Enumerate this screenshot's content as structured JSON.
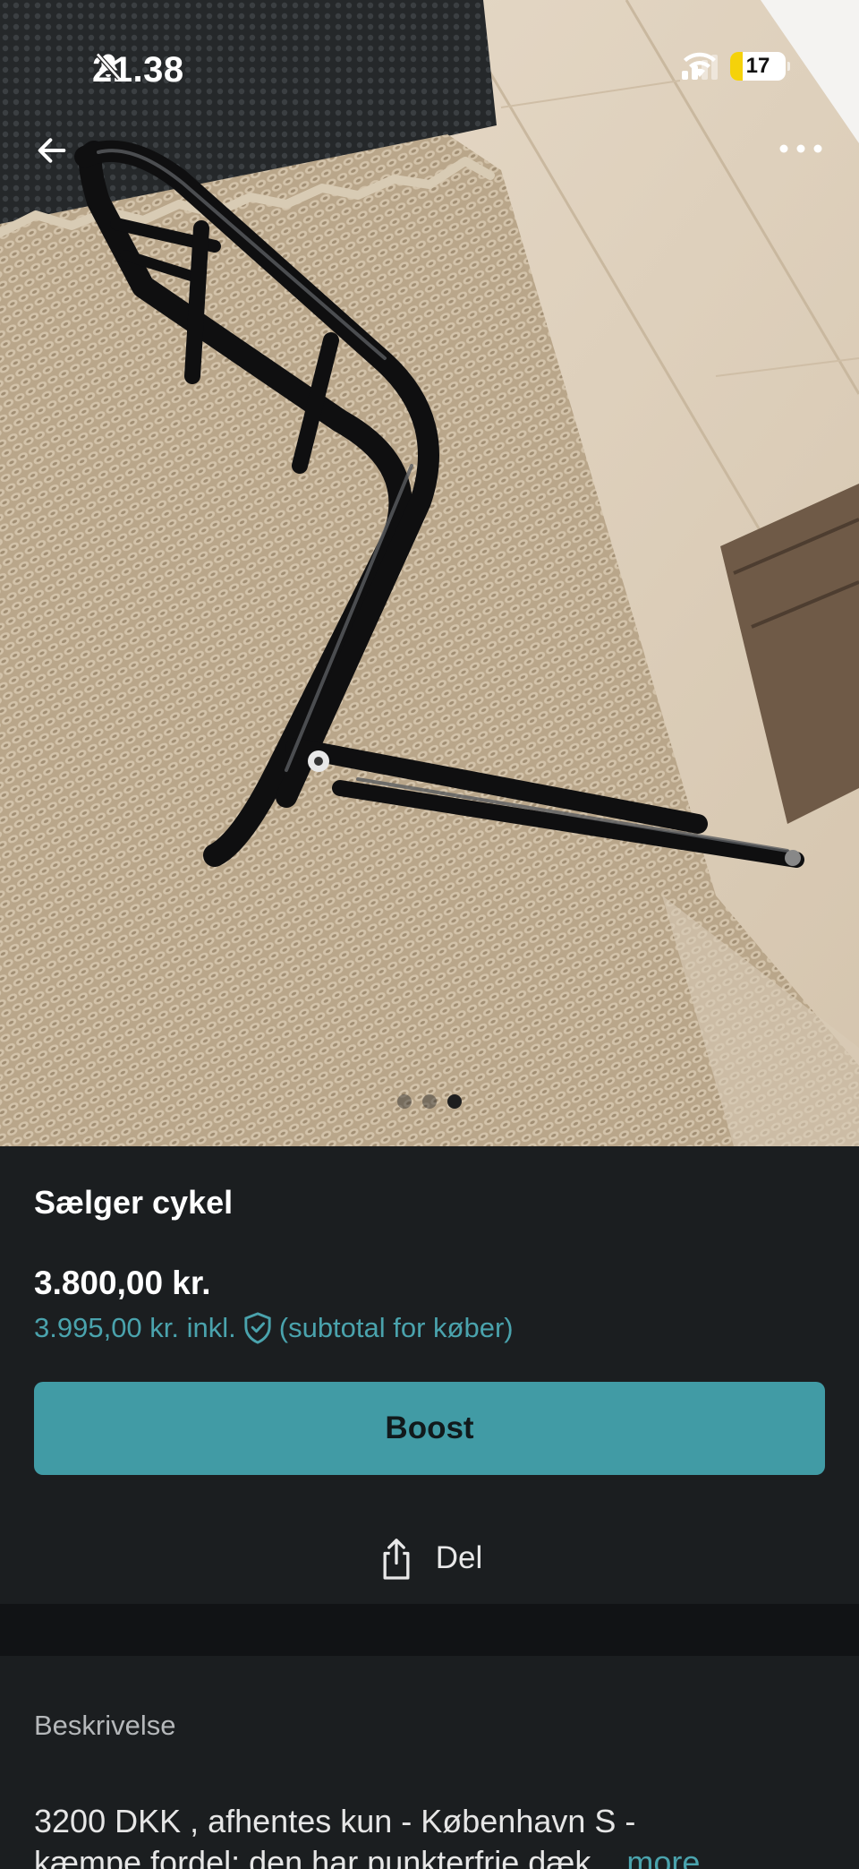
{
  "status_bar": {
    "time": "21.38",
    "battery": "17"
  },
  "photo": {
    "page_count": 3,
    "active_index": 2
  },
  "listing": {
    "title": "Sælger cykel",
    "price": "3.800,00 kr.",
    "buyer_price": "3.995,00 kr. inkl.",
    "buyer_note": "(subtotal for køber)"
  },
  "actions": {
    "boost_label": "Boost",
    "share_label": "Del"
  },
  "description": {
    "heading": "Beskrivelse",
    "line1": "3200 DKK , afhentes kun - København S -",
    "line2": "kæmpe fordel: den har punkterfrie dæk...",
    "more_label": "more"
  },
  "colors": {
    "accent": "#419ba5",
    "link": "#4aa3ad",
    "background": "#1b1e20"
  }
}
